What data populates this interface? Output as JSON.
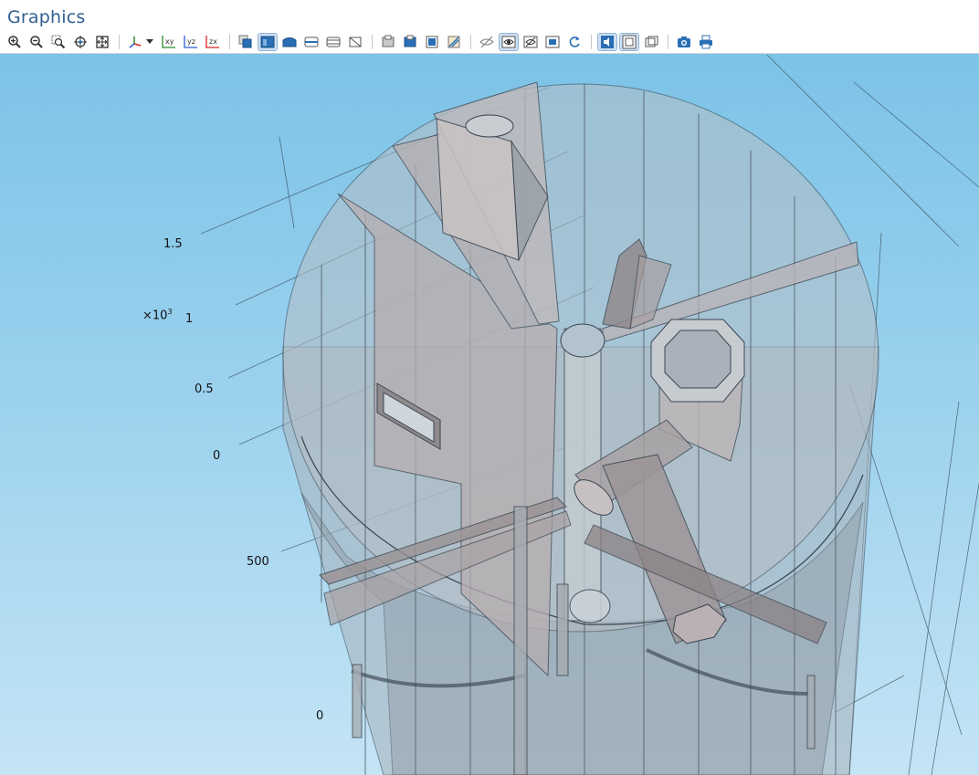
{
  "window": {
    "title": "Graphics"
  },
  "toolbar": {
    "groups": [
      [
        "zoom-in-icon",
        "zoom-out-icon",
        "zoom-box-icon",
        "zoom-selected-icon",
        "zoom-extents-icon"
      ],
      [
        "view-orientation-icon",
        "view-orientation-dropdown-icon",
        "view-xy-icon",
        "view-yz-icon",
        "view-zx-icon"
      ],
      [
        "select-box-icon",
        "select-domains-icon",
        "select-boundaries-icon",
        "select-edges-icon",
        "select-points-icon",
        "clear-selection-icon"
      ],
      [
        "hide-geometric-entities-icon",
        "show-only-selected-icon",
        "hide-selected-icon",
        "reset-hiding-icon"
      ],
      [
        "transparency-toggle-icon",
        "wireframe-rendering-icon",
        "render-toggle-icon",
        "render-box-icon",
        "refresh-icon"
      ],
      [
        "light-toggle-icon",
        "show-grid-icon",
        "show-axes-icon"
      ],
      [
        "image-snapshot-icon",
        "print-icon"
      ]
    ],
    "labels": {
      "xy": "xy",
      "yz": "yz",
      "zx": "zx"
    }
  },
  "axes": {
    "exponent_base": "×10",
    "exponent_power": "3",
    "z_ticks": [
      "1.5",
      "1",
      "0.5",
      "0"
    ],
    "y_ticks": [
      "500",
      "0"
    ]
  }
}
